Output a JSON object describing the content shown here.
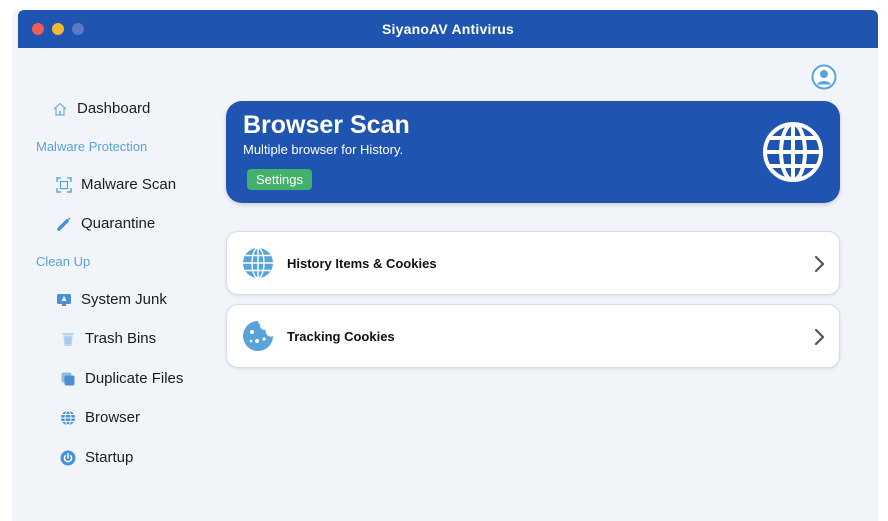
{
  "window": {
    "title": "SiyanoAV Antivirus"
  },
  "colors": {
    "brand": "#1f55b0",
    "accent_light": "#5aa3d8",
    "settings_green": "#43b06b",
    "background": "#f1f4f8"
  },
  "sidebar": {
    "dashboard": {
      "label": "Dashboard",
      "icon": "home-icon"
    },
    "sections": [
      {
        "label": "Malware Protection",
        "items": [
          {
            "label": "Malware Scan",
            "icon": "scan-icon"
          },
          {
            "label": "Quarantine",
            "icon": "syringe-icon"
          }
        ]
      },
      {
        "label": "Clean Up",
        "items": [
          {
            "label": "System Junk",
            "icon": "monitor-icon"
          },
          {
            "label": "Trash Bins",
            "icon": "trash-icon"
          },
          {
            "label": "Duplicate Files",
            "icon": "duplicate-icon"
          },
          {
            "label": "Browser",
            "icon": "globe-icon"
          },
          {
            "label": "Startup",
            "icon": "power-icon"
          }
        ]
      }
    ]
  },
  "header": {
    "profile_icon": "user-icon"
  },
  "hero": {
    "title": "Browser Scan",
    "subtitle": "Multiple browser for History.",
    "settings_label": "Settings",
    "icon": "globe-icon"
  },
  "options": [
    {
      "label": "History Items & Cookies",
      "icon": "globe-icon"
    },
    {
      "label": "Tracking Cookies",
      "icon": "cookie-icon"
    }
  ]
}
